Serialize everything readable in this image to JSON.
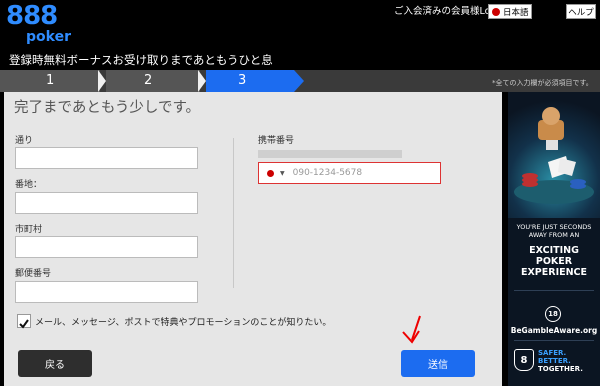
{
  "header": {
    "logo_number": "888",
    "logo_word": "poker",
    "login_text": "ご入会済みの会員様Login",
    "language": "日本語",
    "help": "ヘルプ"
  },
  "title": "登録時無料ボーナスお受け取りまであともうひと息",
  "steps": [
    "1",
    "2",
    "3"
  ],
  "required_note": "*全ての入力欄が必須項目です。",
  "form": {
    "heading": "完了まであともう少しです。",
    "street_label": "通り",
    "address_label": "番地：",
    "city_label": "市町村",
    "postcode_label": "郵便番号",
    "phone_label": "携帯番号",
    "phone_placeholder": "090-1234-5678",
    "checkbox_label": "メール、メッセージ、ポストで特典やプロモーションのことが知りたい。",
    "back": "戻る",
    "submit": "送信"
  },
  "ad": {
    "line1": "YOU'RE JUST SECONDS",
    "line2": "AWAY FROM AN",
    "line3": "EXCITING",
    "line4": "POKER",
    "line5": "EXPERIENCE",
    "age": "18",
    "aware": "BeGambleAware.org",
    "safer1": "SAFER.",
    "safer2": "BETTER.",
    "safer3": "TOGETHER."
  },
  "colors": {
    "accent": "#1c6cf0",
    "brand_logo": "#2f8cff",
    "error_border": "#dd3333"
  }
}
